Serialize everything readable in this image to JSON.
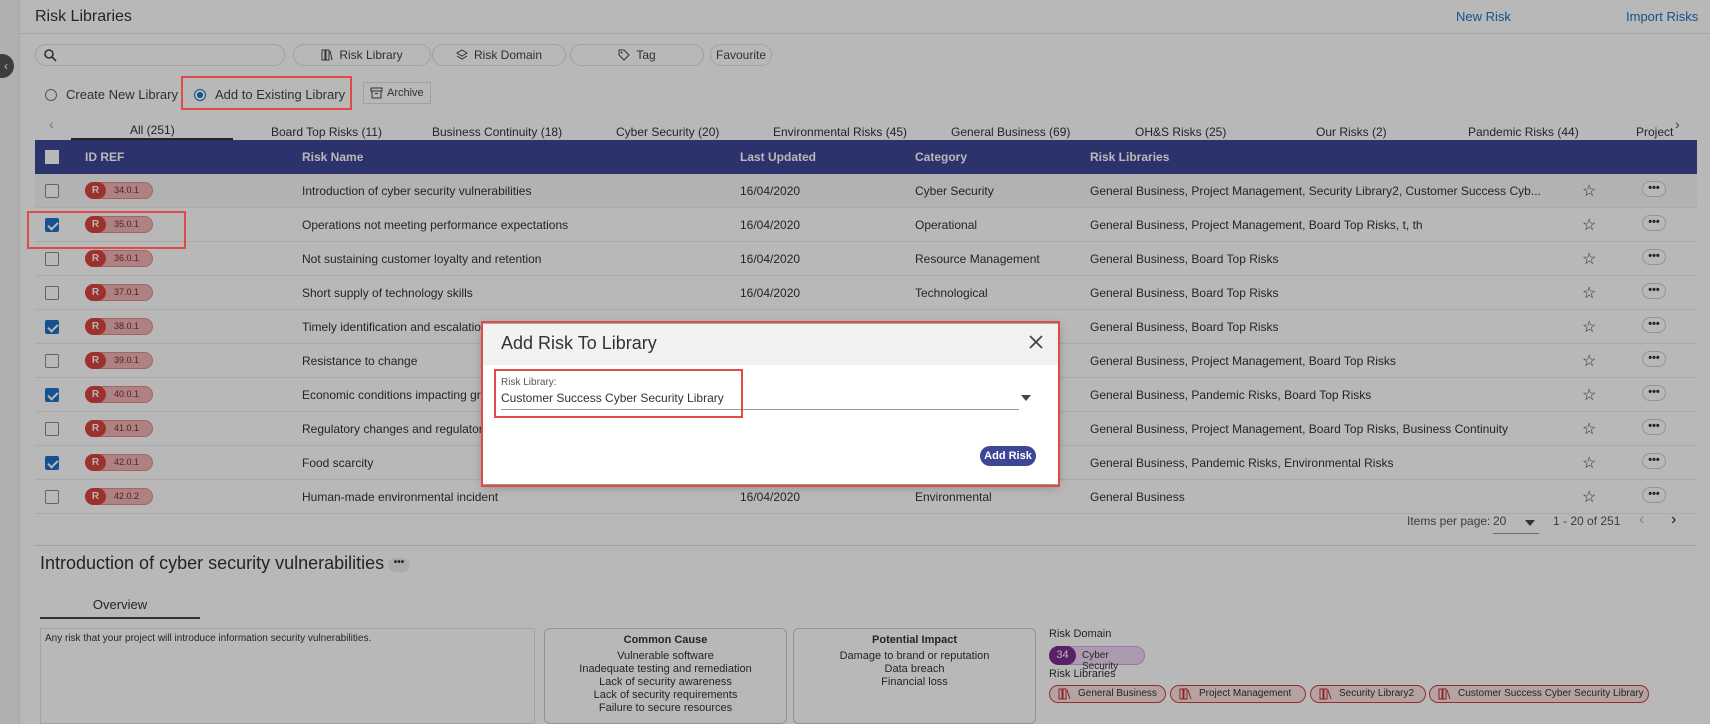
{
  "header": {
    "title": "Risk Libraries",
    "new_risk": "New Risk",
    "import_risks": "Import Risks"
  },
  "filters": {
    "search_placeholder": "",
    "risk_library": "Risk Library",
    "risk_domain": "Risk Domain",
    "tag": "Tag",
    "favourite": "Favourite"
  },
  "mode": {
    "create_new": "Create New Library",
    "add_existing": "Add to Existing Library",
    "selected": "add_existing",
    "archive": "Archive"
  },
  "tabs": [
    {
      "label": "All (251)"
    },
    {
      "label": "Board Top Risks (11)"
    },
    {
      "label": "Business Continuity (18)"
    },
    {
      "label": "Cyber Security (20)"
    },
    {
      "label": "Environmental Risks (45)"
    },
    {
      "label": "General Business (69)"
    },
    {
      "label": "OH&S Risks (25)"
    },
    {
      "label": "Our Risks (2)"
    },
    {
      "label": "Pandemic Risks (44)"
    },
    {
      "label": "Project"
    }
  ],
  "table": {
    "columns": {
      "id_ref": "ID REF",
      "risk_name": "Risk Name",
      "last_updated": "Last Updated",
      "category": "Category",
      "risk_libraries": "Risk Libraries"
    },
    "rows": [
      {
        "checked": false,
        "badge": "R",
        "id": "34.0.1",
        "name": "Introduction of cyber security vulnerabilities",
        "updated": "16/04/2020",
        "category": "Cyber Security",
        "libraries": "General Business, Project Management, Security Library2, Customer Success Cyb..."
      },
      {
        "checked": true,
        "badge": "R",
        "id": "35.0.1",
        "name": "Operations not meeting performance expectations",
        "updated": "16/04/2020",
        "category": "Operational",
        "libraries": "General Business, Project Management, Board Top Risks, t, th"
      },
      {
        "checked": false,
        "badge": "R",
        "id": "36.0.1",
        "name": "Not sustaining customer loyalty and retention",
        "updated": "16/04/2020",
        "category": "Resource Management",
        "libraries": "General Business, Board Top Risks"
      },
      {
        "checked": false,
        "badge": "R",
        "id": "37.0.1",
        "name": "Short supply of technology skills",
        "updated": "16/04/2020",
        "category": "Technological",
        "libraries": "General Business, Board Top Risks"
      },
      {
        "checked": true,
        "badge": "R",
        "id": "38.0.1",
        "name": "Timely identification and escalation",
        "updated": "",
        "category": "",
        "libraries": "General Business, Board Top Risks"
      },
      {
        "checked": false,
        "badge": "R",
        "id": "39.0.1",
        "name": "Resistance to change",
        "updated": "",
        "category": "",
        "libraries": "General Business, Project Management, Board Top Risks"
      },
      {
        "checked": true,
        "badge": "R",
        "id": "40.0.1",
        "name": "Economic conditions impacting gro",
        "updated": "",
        "category": "",
        "libraries": "General Business, Pandemic Risks, Board Top Risks"
      },
      {
        "checked": false,
        "badge": "R",
        "id": "41.0.1",
        "name": "Regulatory changes and regulatory",
        "updated": "",
        "category": "",
        "libraries": "General Business, Project Management, Board Top Risks, Business Continuity"
      },
      {
        "checked": true,
        "badge": "R",
        "id": "42.0.1",
        "name": "Food scarcity",
        "updated": "",
        "category": "",
        "libraries": "General Business, Pandemic Risks, Environmental Risks"
      },
      {
        "checked": false,
        "badge": "R",
        "id": "42.0.2",
        "name": "Human-made environmental incident",
        "updated": "16/04/2020",
        "category": "Environmental",
        "libraries": "General Business"
      }
    ]
  },
  "pager": {
    "items_per_page_label": "Items per page:",
    "items_per_page": "20",
    "range": "1 - 20 of 251"
  },
  "detail": {
    "title": "Introduction of cyber security vulnerabilities",
    "tab": "Overview",
    "description": "Any risk that your project will introduce information security vulnerabilities.",
    "common_cause": {
      "title": "Common Cause",
      "lines": [
        "Vulnerable software",
        "Inadequate testing and remediation",
        "Lack of security awareness",
        "Lack of security requirements",
        "Failure to secure resources"
      ]
    },
    "potential_impact": {
      "title": "Potential Impact",
      "lines": [
        "Damage to brand or reputation",
        "Data breach",
        "Financial loss"
      ]
    },
    "risk_domain_label": "Risk Domain",
    "domain_number": "34",
    "domain_name": "Cyber Security",
    "risk_libraries_label": "Risk Libraries",
    "libraries": [
      "General Business",
      "Project Management",
      "Security Library2",
      "Customer Success Cyber Security Library"
    ]
  },
  "dialog": {
    "title": "Add Risk To Library",
    "field_label": "Risk Library:",
    "field_value": "Customer Success Cyber Security Library",
    "submit": "Add Risk"
  },
  "colors": {
    "header_bg": "#3d4796",
    "link": "#1a73c9",
    "badge_red": "#d8443f",
    "highlight": "#e24a4a",
    "checkbox": "#1c73c6"
  }
}
